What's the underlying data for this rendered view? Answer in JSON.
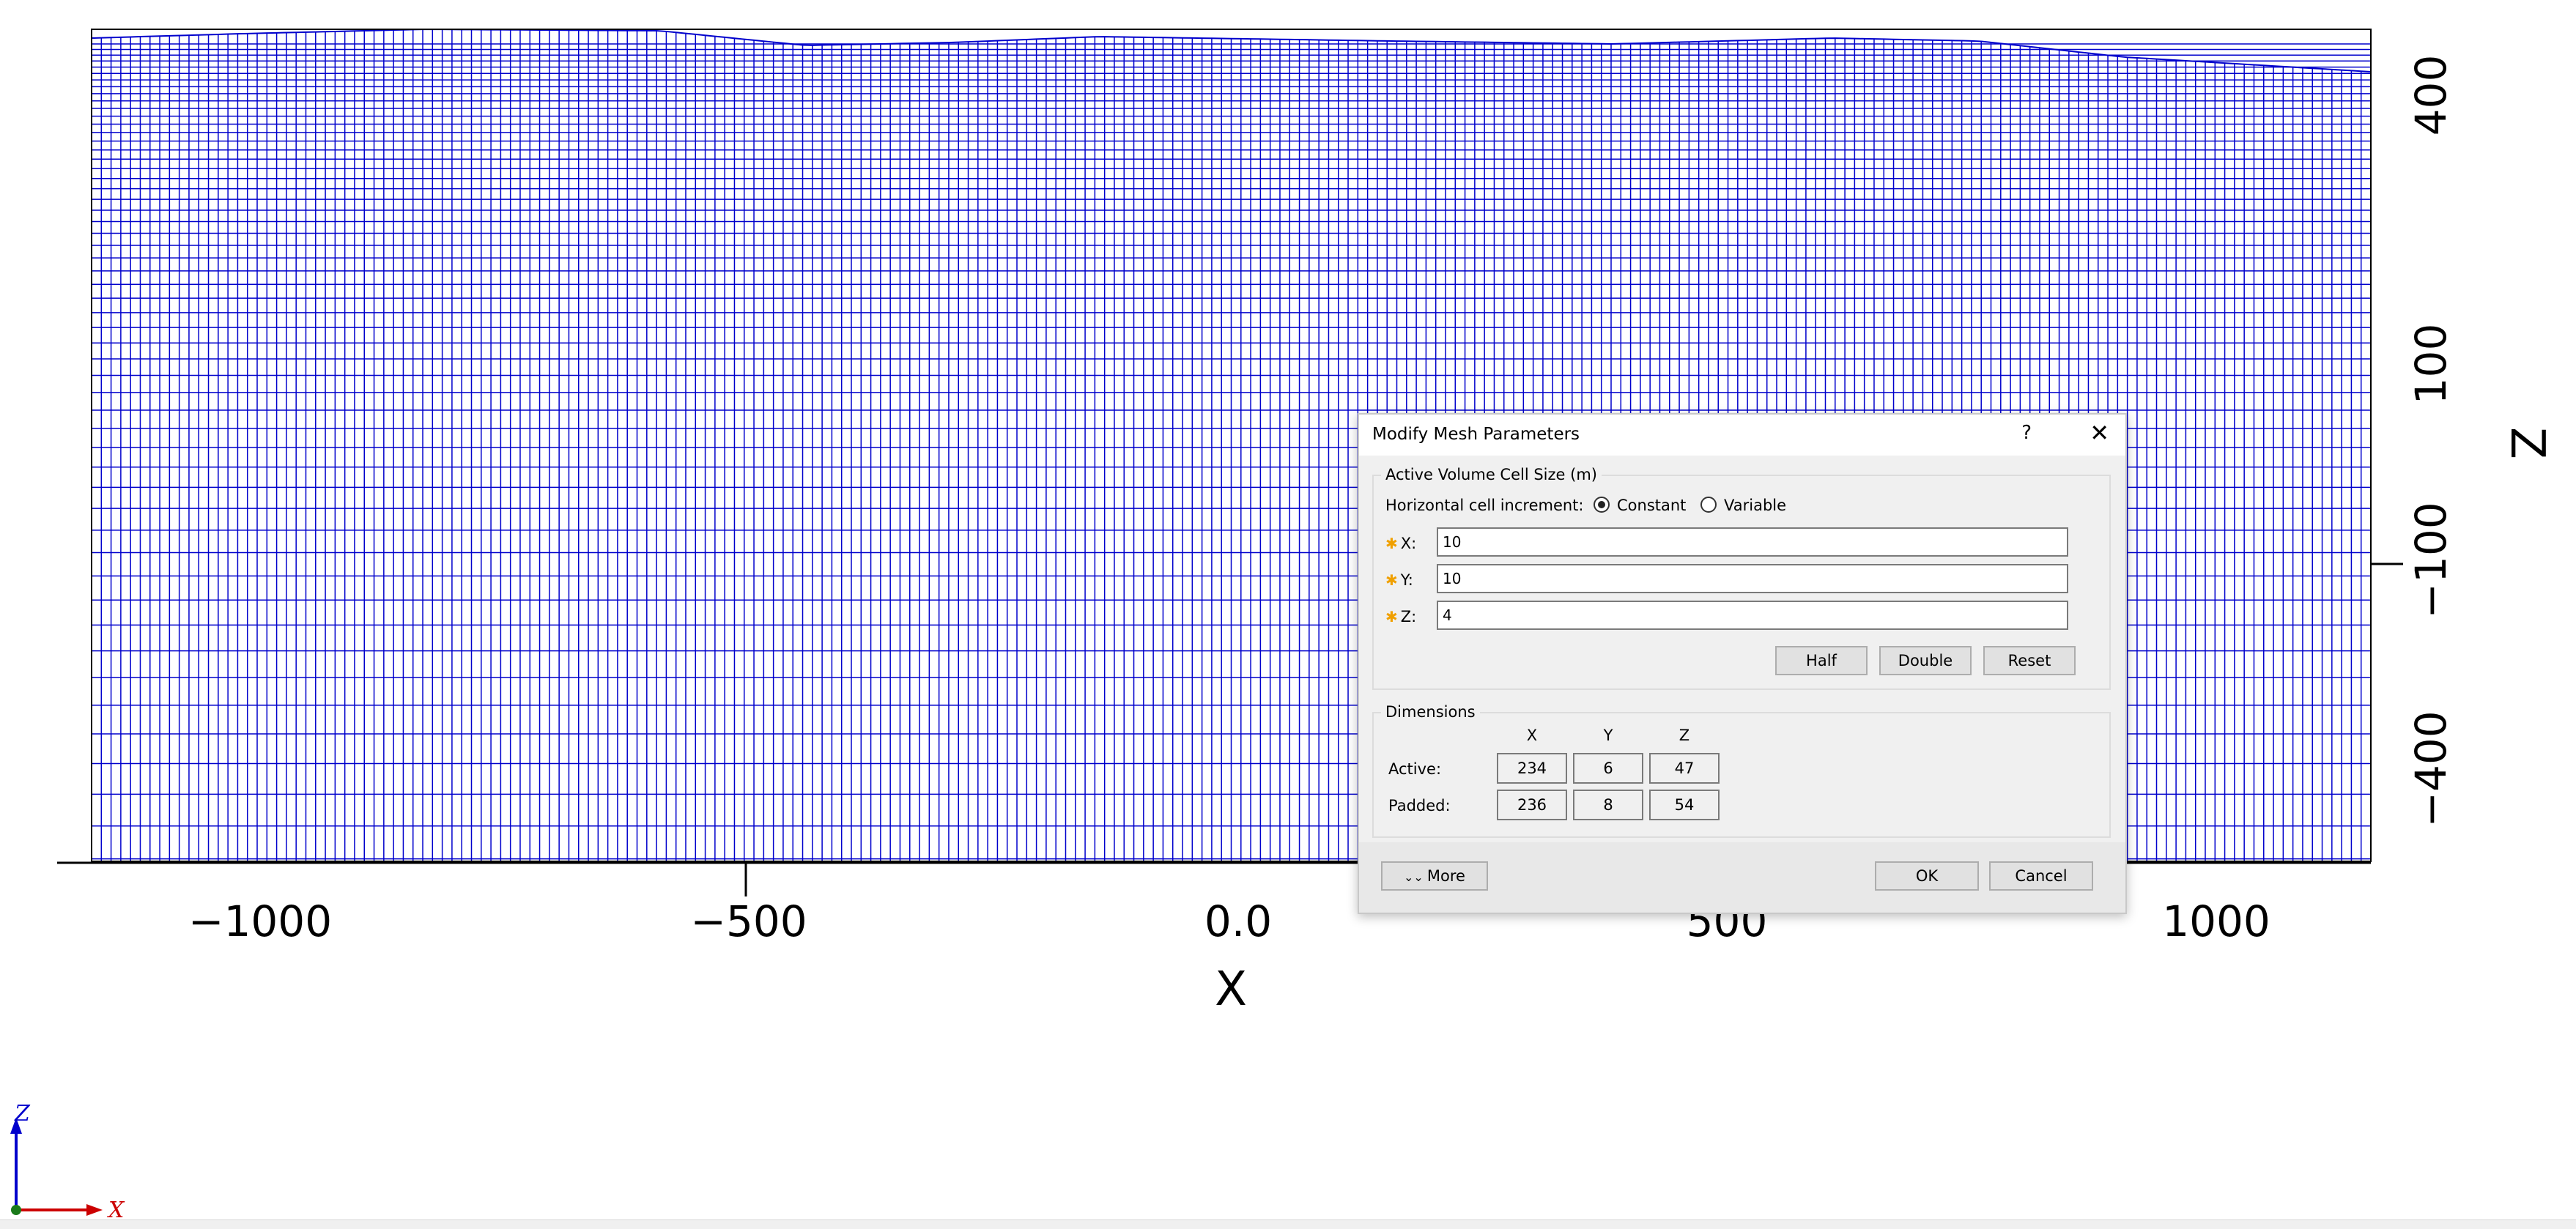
{
  "plot": {
    "x_ticks": [
      "−1000",
      "−500",
      "0.0",
      "500",
      "1000"
    ],
    "x_label": "X",
    "z_ticks": [
      "400",
      "100",
      "−100",
      "−400"
    ],
    "z_label": "Z",
    "mesh_color": "#0000cc"
  },
  "triad": {
    "z": "Z",
    "x": "X"
  },
  "dialog": {
    "title": "Modify Mesh Parameters",
    "help": "?",
    "close": "✕",
    "active_group_title": "Active Volume Cell Size (m)",
    "horizontal_label": "Horizontal cell increment:",
    "radio_constant": "Constant",
    "radio_variable": "Variable",
    "req_mark": "✱",
    "x_label": "X:",
    "y_label": "Y:",
    "z_label": "Z:",
    "x_value": "10",
    "y_value": "10",
    "z_value": "4",
    "half": "Half",
    "double": "Double",
    "reset": "Reset",
    "dimensions_title": "Dimensions",
    "col_x": "X",
    "col_y": "Y",
    "col_z": "Z",
    "active_label": "Active:",
    "padded_label": "Padded:",
    "active": [
      "234",
      "6",
      "47"
    ],
    "padded": [
      "236",
      "8",
      "54"
    ],
    "more": "More",
    "ok": "OK",
    "cancel": "Cancel"
  }
}
